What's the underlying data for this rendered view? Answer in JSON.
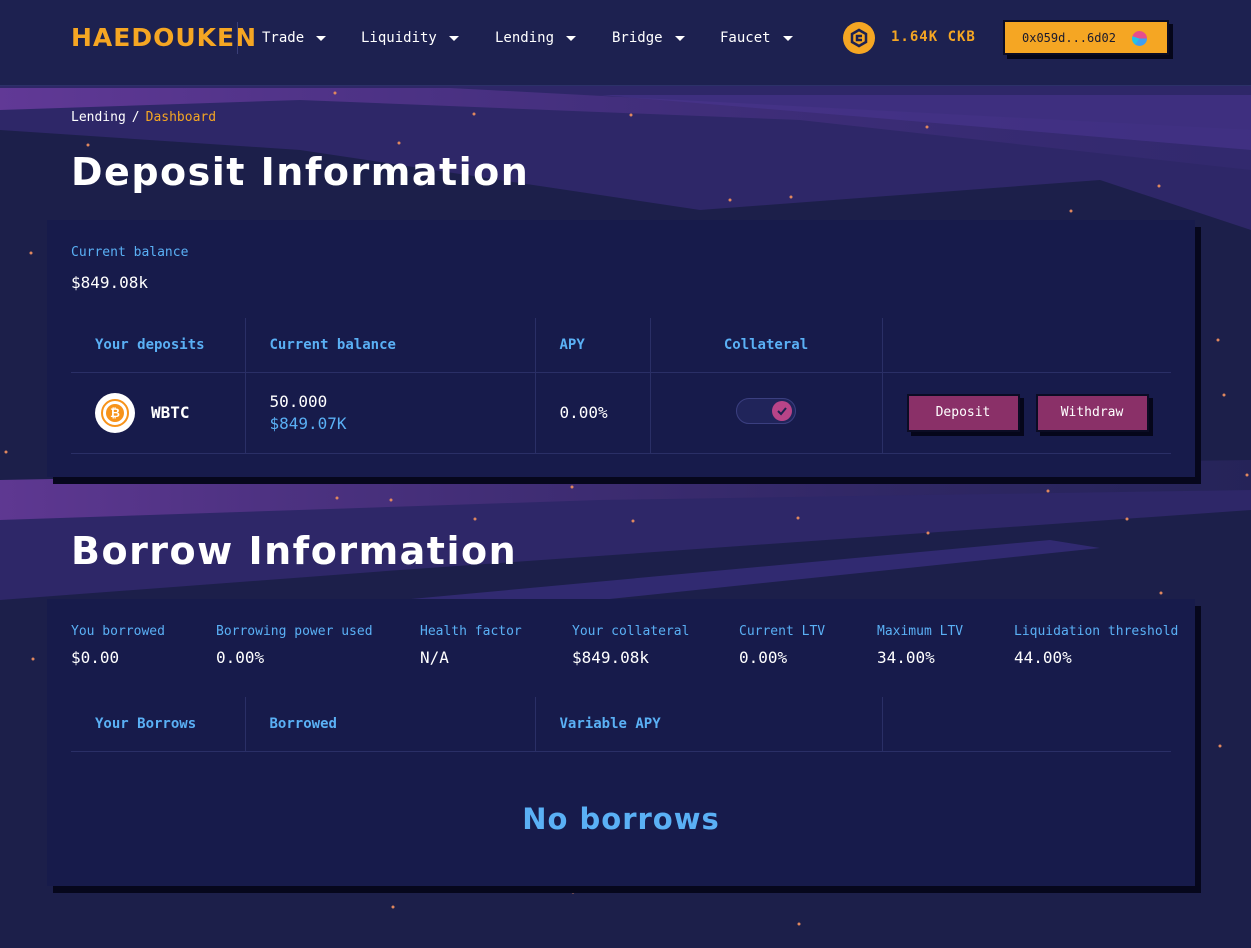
{
  "header": {
    "logo": "HAEDOUKEN",
    "nav": [
      {
        "label": "Trade"
      },
      {
        "label": "Liquidity"
      },
      {
        "label": "Lending"
      },
      {
        "label": "Bridge"
      },
      {
        "label": "Faucet"
      }
    ],
    "ckb_balance": "1.64K CKB",
    "wallet_address": "0x059d...6d02"
  },
  "breadcrumb": {
    "parent": "Lending",
    "separator": "/",
    "current": "Dashboard"
  },
  "deposit": {
    "title": "Deposit Information",
    "current_balance_label": "Current balance",
    "current_balance_value": "$849.08k",
    "table": {
      "headers": [
        "Your deposits",
        "Current balance",
        "APY",
        "Collateral"
      ],
      "rows": [
        {
          "asset": "WBTC",
          "amount": "50.000",
          "amount_usd": "$849.07K",
          "apy": "0.00%",
          "collateral_enabled": true,
          "deposit_label": "Deposit",
          "withdraw_label": "Withdraw"
        }
      ]
    }
  },
  "borrow": {
    "title": "Borrow Information",
    "stats": [
      {
        "label": "You borrowed",
        "value": "$0.00"
      },
      {
        "label": "Borrowing power used",
        "value": "0.00%"
      },
      {
        "label": "Health factor",
        "value": "N/A"
      },
      {
        "label": "Your collateral",
        "value": "$849.08k"
      },
      {
        "label": "Current LTV",
        "value": "0.00%"
      },
      {
        "label": "Maximum LTV",
        "value": "34.00%"
      },
      {
        "label": "Liquidation threshold",
        "value": "44.00%"
      }
    ],
    "table": {
      "headers": [
        "Your Borrows",
        "Borrowed",
        "Variable APY"
      ]
    },
    "empty_text": "No borrows"
  },
  "colors": {
    "background": "#1c1f4a",
    "card": "#171b4b",
    "accent_orange": "#f5a623",
    "accent_blue": "#5ab0f5",
    "button": "#8a3068"
  }
}
